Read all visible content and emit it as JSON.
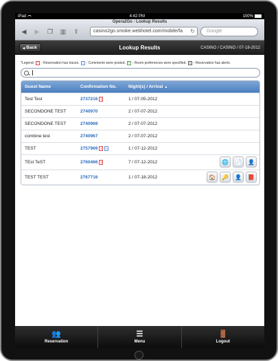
{
  "status": {
    "device": "iPad",
    "time": "4:42 PM",
    "battery": "100%"
  },
  "browser": {
    "title": "Opera2Go - Lookup Results",
    "url": "casino2go.smoke.webhotel.com/mobile/fa",
    "search_placeholder": "Google"
  },
  "header": {
    "back_label": "Back",
    "title": "Lookup Results",
    "info": "CASINO / CASINO / 07-18-2012"
  },
  "legend": {
    "prefix": "*Legend:",
    "traces": "- Reservation has traces.",
    "comments": "- Comments were posted.",
    "prefs": "- Room preferences were specified.",
    "alerts": "- Reservation has alerts."
  },
  "table": {
    "headers": {
      "guest": "Guest Name",
      "conf": "Confirmation No.",
      "night": "Night(s) / Arrival"
    },
    "rows": [
      {
        "guest": "Test Test",
        "conf": "2737216",
        "night": "1 / 07-05-2012"
      },
      {
        "guest": "SECONDONE TEST",
        "conf": "2740970",
        "night": "2 / 07-07-2012"
      },
      {
        "guest": "SECONDONE TEST",
        "conf": "2740969",
        "night": "2 / 07-07-2012"
      },
      {
        "guest": "combine test",
        "conf": "2740967",
        "night": "2 / 07-07-2012"
      },
      {
        "guest": "TEST",
        "conf": "2757969",
        "night": "1 / 07-12-2012"
      },
      {
        "guest": "TEst TeST",
        "conf": "2760466",
        "night": "7 / 07-12-2012"
      },
      {
        "guest": "TEST TEST",
        "conf": "2767716",
        "night": "1 / 07-18-2012"
      }
    ]
  },
  "tabs": {
    "reservation": "Reservation",
    "menu": "Menu",
    "logout": "Logout"
  }
}
